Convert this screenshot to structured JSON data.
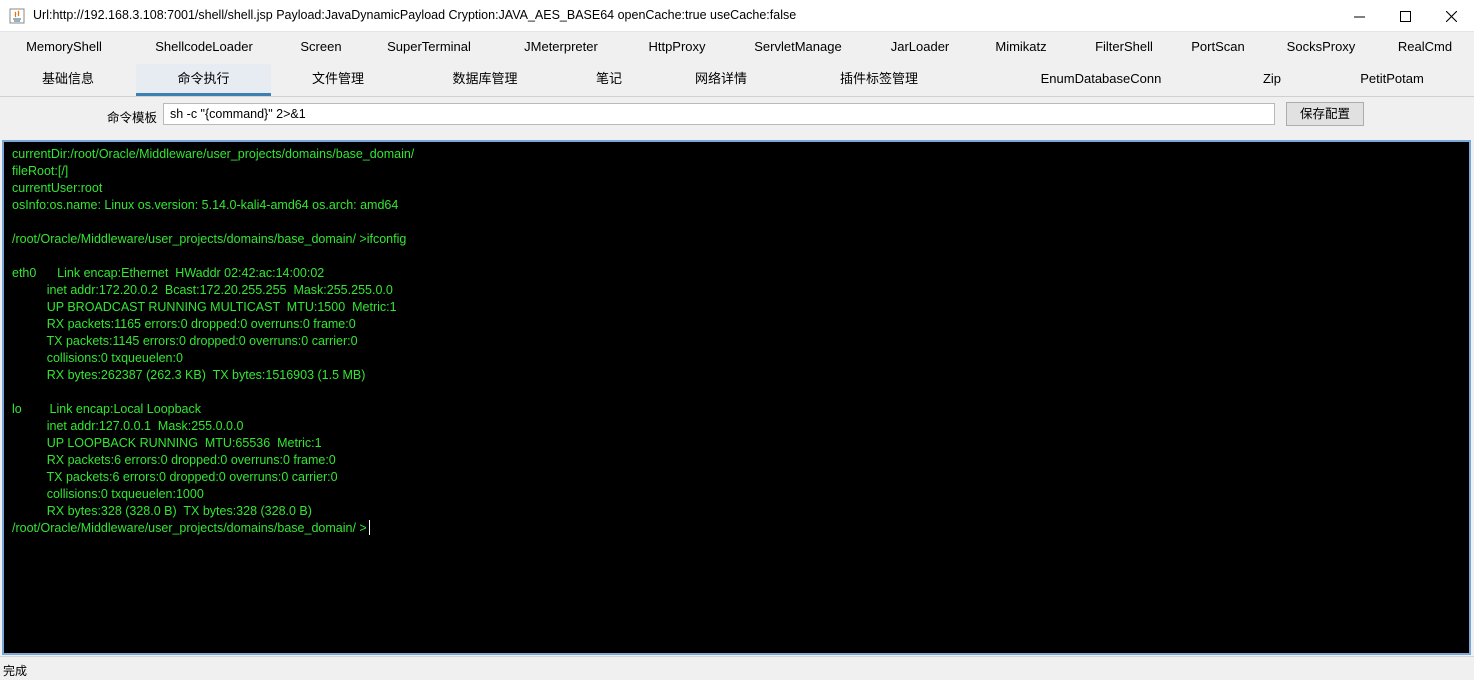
{
  "window": {
    "title": "Url:http://192.168.3.108:7001/shell/shell.jsp Payload:JavaDynamicPayload Cryption:JAVA_AES_BASE64 openCache:true useCache:false",
    "icons": {
      "app": "java-app-icon",
      "minimize": "minimize-icon",
      "maximize": "maximize-icon",
      "close": "close-icon"
    }
  },
  "plugin_tabs": [
    {
      "label": "MemoryShell"
    },
    {
      "label": "ShellcodeLoader"
    },
    {
      "label": "Screen"
    },
    {
      "label": "SuperTerminal"
    },
    {
      "label": "JMeterpreter"
    },
    {
      "label": "HttpProxy"
    },
    {
      "label": "ServletManage"
    },
    {
      "label": "JarLoader"
    },
    {
      "label": "Mimikatz"
    },
    {
      "label": "FilterShell"
    },
    {
      "label": "PortScan"
    },
    {
      "label": "SocksProxy"
    },
    {
      "label": "RealCmd"
    }
  ],
  "main_tabs": [
    {
      "label": "基础信息"
    },
    {
      "label": "命令执行",
      "selected": true
    },
    {
      "label": "文件管理"
    },
    {
      "label": "数据库管理"
    },
    {
      "label": "笔记"
    },
    {
      "label": "网络详情"
    },
    {
      "label": "插件标签管理"
    },
    {
      "label": "EnumDatabaseConn"
    },
    {
      "label": "Zip"
    },
    {
      "label": "PetitPotam"
    }
  ],
  "command": {
    "template_label": "命令模板",
    "template_value": "sh -c \"{command}\" 2>&1",
    "save_label": "保存配置"
  },
  "console": {
    "text": "currentDir:/root/Oracle/Middleware/user_projects/domains/base_domain/\nfileRoot:[/]\ncurrentUser:root\nosInfo:os.name: Linux os.version: 5.14.0-kali4-amd64 os.arch: amd64\n\n/root/Oracle/Middleware/user_projects/domains/base_domain/ >ifconfig\n\neth0      Link encap:Ethernet  HWaddr 02:42:ac:14:00:02  \n          inet addr:172.20.0.2  Bcast:172.20.255.255  Mask:255.255.0.0\n          UP BROADCAST RUNNING MULTICAST  MTU:1500  Metric:1\n          RX packets:1165 errors:0 dropped:0 overruns:0 frame:0\n          TX packets:1145 errors:0 dropped:0 overruns:0 carrier:0\n          collisions:0 txqueuelen:0 \n          RX bytes:262387 (262.3 KB)  TX bytes:1516903 (1.5 MB)\n\nlo        Link encap:Local Loopback  \n          inet addr:127.0.0.1  Mask:255.0.0.0\n          UP LOOPBACK RUNNING  MTU:65536  Metric:1\n          RX packets:6 errors:0 dropped:0 overruns:0 frame:0\n          TX packets:6 errors:0 dropped:0 overruns:0 carrier:0\n          collisions:0 txqueuelen:1000 \n          RX bytes:328 (328.0 B)  TX bytes:328 (328.0 B)\n/root/Oracle/Middleware/user_projects/domains/base_domain/ >",
    "text_color": "#33e633",
    "background": "#000000"
  },
  "status": {
    "text": "完成"
  },
  "colors": {
    "selected_tab_underline": "#3c7fb1",
    "console_border": "#7aa7d9"
  }
}
